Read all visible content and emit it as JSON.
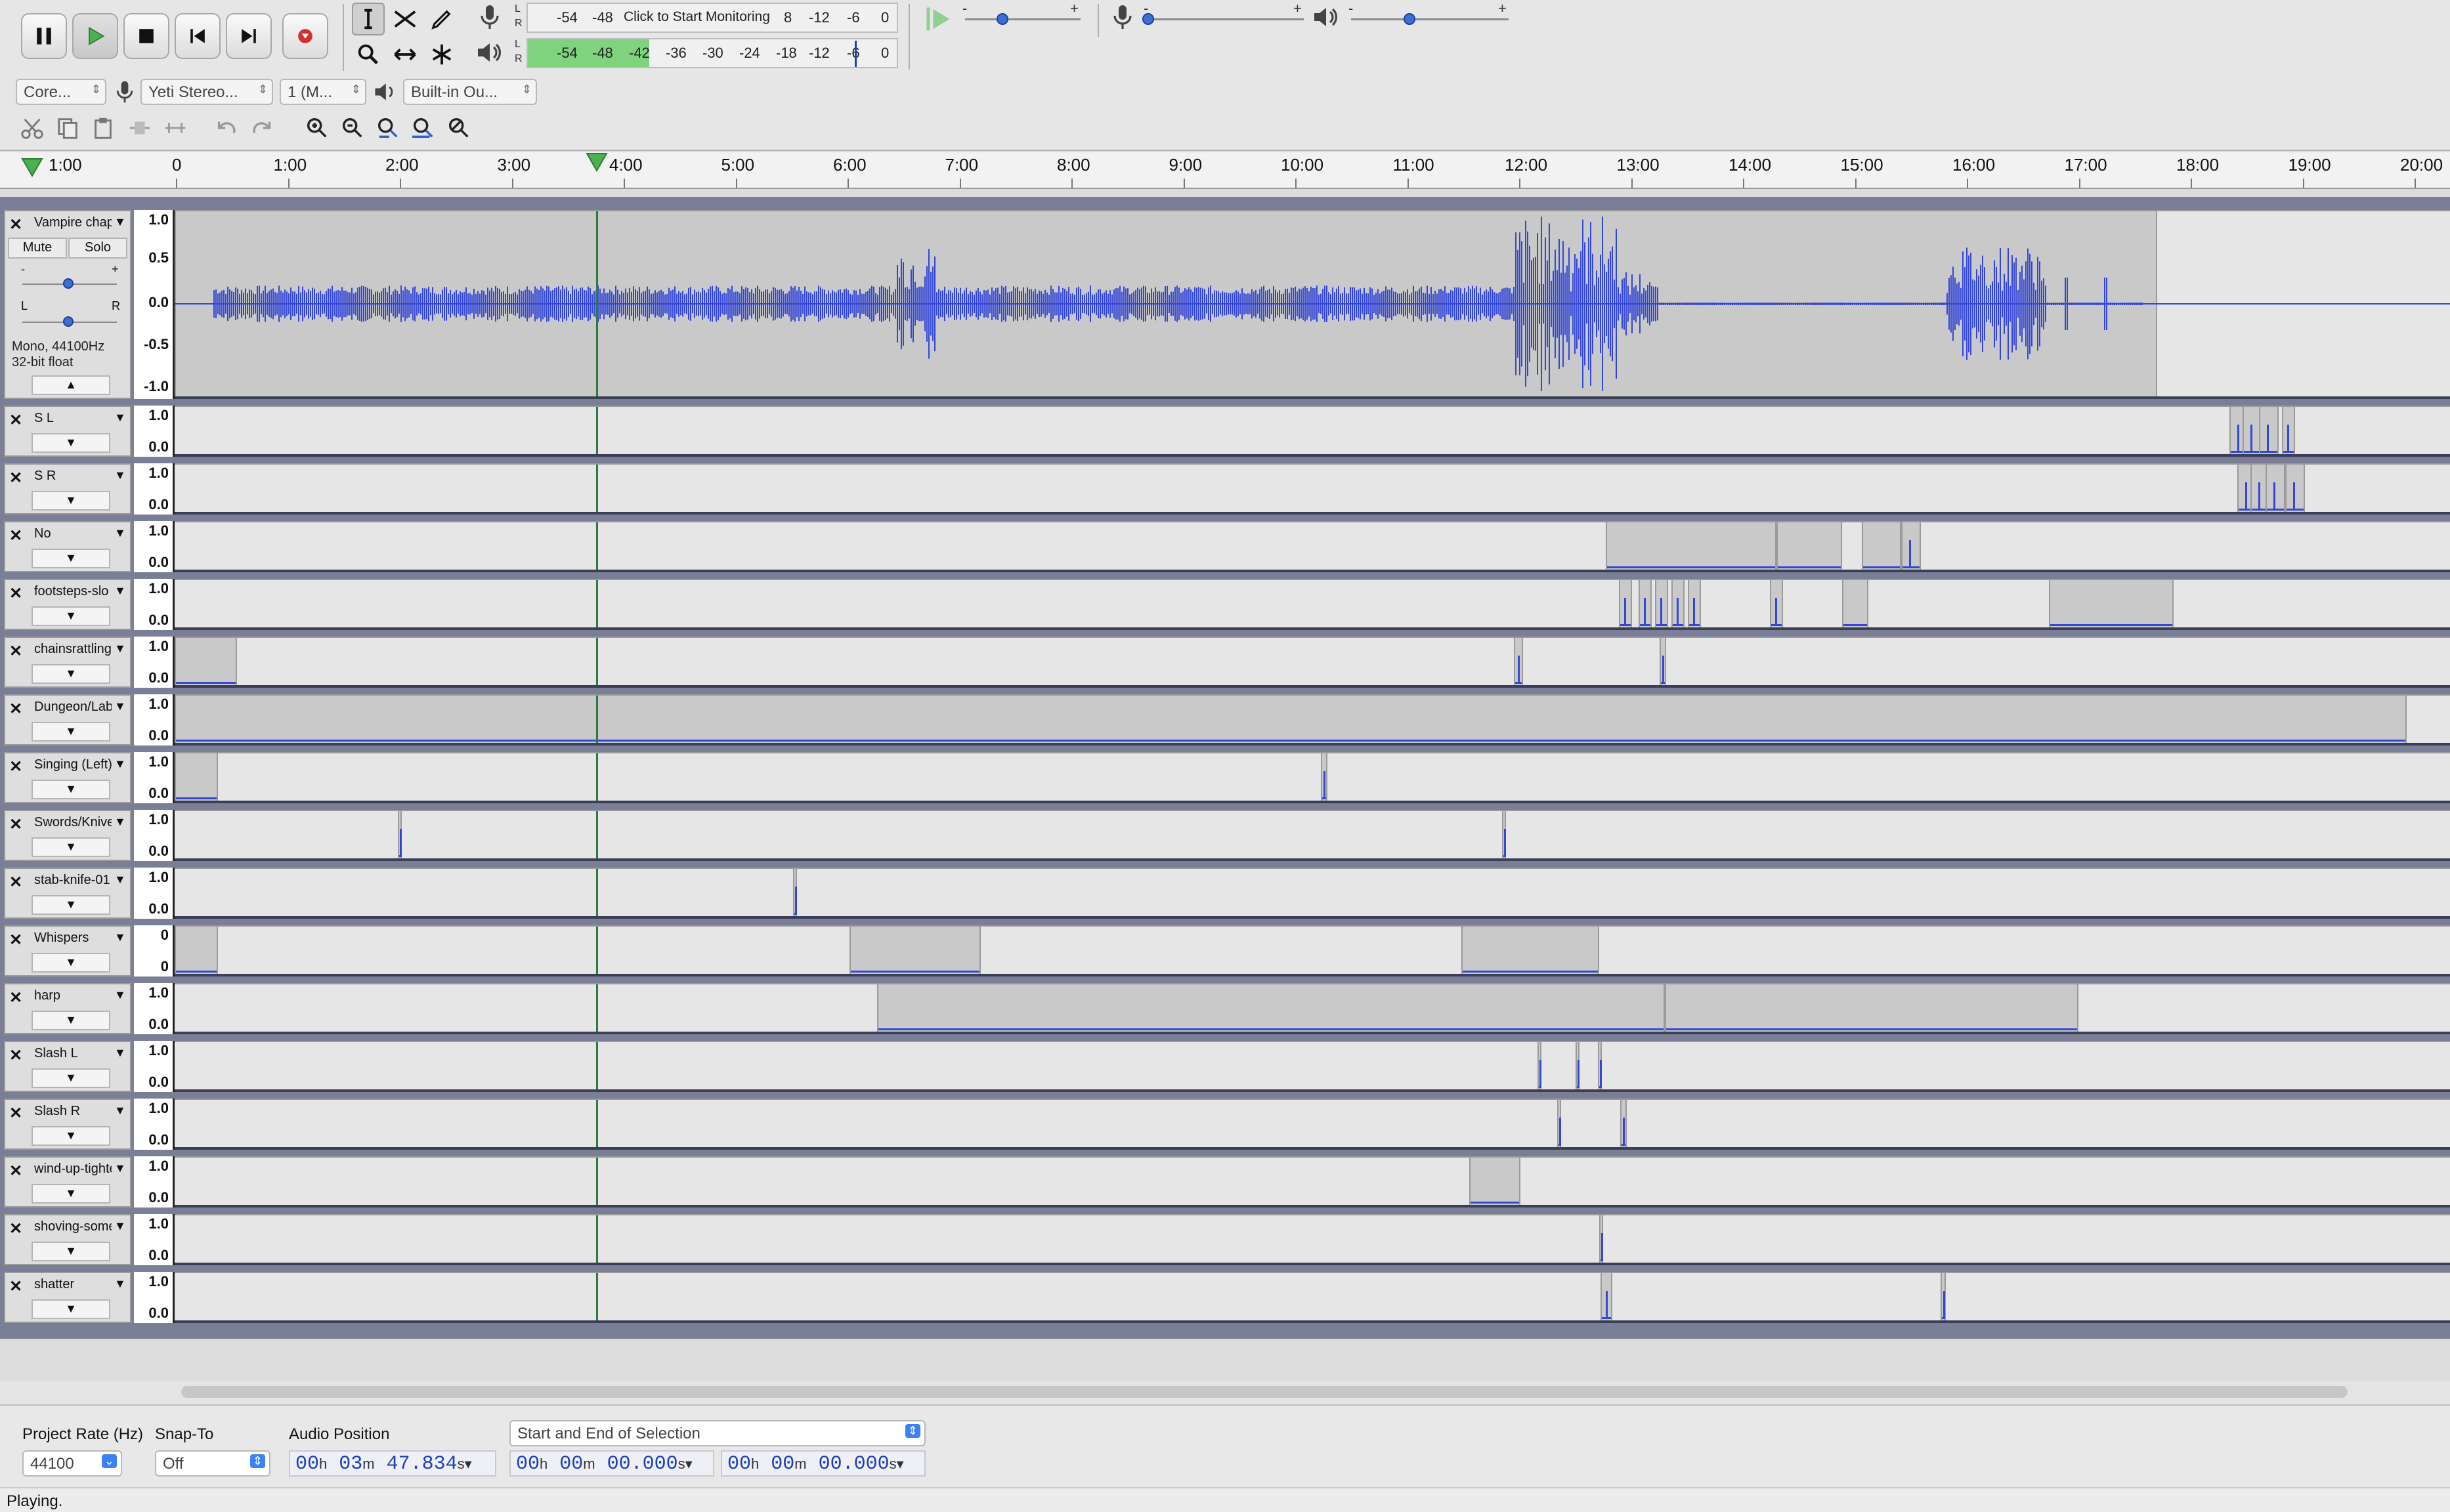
{
  "toolbar": {
    "monitor_text": "Click to Start Monitoring",
    "rec_ticks": [
      "-54",
      "-48",
      "8",
      "-12",
      "-6",
      "0"
    ],
    "play_ticks": [
      "-54",
      "-48",
      "-42",
      "-36",
      "-30",
      "-24",
      "-18",
      "-12",
      "-6",
      "0"
    ],
    "meter_l": "L",
    "meter_r": "R",
    "slider_minus": "-",
    "slider_plus": "+",
    "play_meter_level": 0.33
  },
  "devices": {
    "host": "Core...",
    "input": "Yeti Stereo...",
    "channels": "1 (M...",
    "output": "Built-in Ou..."
  },
  "ruler": {
    "start_label": "1:00",
    "labels": [
      "0",
      "1:00",
      "2:00",
      "3:00",
      "4:00",
      "5:00",
      "6:00",
      "7:00",
      "8:00",
      "9:00",
      "10:00",
      "11:00",
      "12:00",
      "13:00",
      "14:00",
      "15:00",
      "16:00",
      "17:00",
      "18:00",
      "19:00",
      "20:00"
    ]
  },
  "first_track": {
    "name": "Vampire chap",
    "mute": "Mute",
    "solo": "Solo",
    "gain_minus": "-",
    "gain_plus": "+",
    "pan_l": "L",
    "pan_r": "R",
    "format_line1": "Mono, 44100Hz",
    "format_line2": "32-bit float",
    "scale": [
      "1.0",
      "0.5",
      "0.0",
      "-0.5",
      "-1.0"
    ]
  },
  "tracks": [
    {
      "name": "S L",
      "scale_top": "1.0",
      "scale_bottom": "0.0"
    },
    {
      "name": "S R",
      "scale_top": "1.0",
      "scale_bottom": "0.0"
    },
    {
      "name": "No",
      "scale_top": "1.0",
      "scale_bottom": "0.0"
    },
    {
      "name": "footsteps-slo",
      "scale_top": "1.0",
      "scale_bottom": "0.0"
    },
    {
      "name": "chainsrattling",
      "scale_top": "1.0",
      "scale_bottom": "0.0"
    },
    {
      "name": "Dungeon/Lab",
      "scale_top": "1.0",
      "scale_bottom": "0.0"
    },
    {
      "name": "Singing (Left)",
      "scale_top": "1.0",
      "scale_bottom": "0.0"
    },
    {
      "name": "Swords/Knive",
      "scale_top": "1.0",
      "scale_bottom": "0.0"
    },
    {
      "name": "stab-knife-01",
      "scale_top": "1.0",
      "scale_bottom": "0.0"
    },
    {
      "name": "Whispers",
      "scale_top": "0",
      "scale_bottom": "0"
    },
    {
      "name": "harp",
      "scale_top": "1.0",
      "scale_bottom": "0.0"
    },
    {
      "name": "Slash L",
      "scale_top": "1.0",
      "scale_bottom": "0.0"
    },
    {
      "name": "Slash R",
      "scale_top": "1.0",
      "scale_bottom": "0.0"
    },
    {
      "name": "wind-up-tighte",
      "scale_top": "1.0",
      "scale_bottom": "0.0"
    },
    {
      "name": "shoving-some",
      "scale_top": "1.0",
      "scale_bottom": "0.0"
    },
    {
      "name": "shatter",
      "scale_top": "1.0",
      "scale_bottom": "0.0"
    }
  ],
  "selection_bar": {
    "project_rate_label": "Project Rate (Hz)",
    "project_rate": "44100",
    "snap_to_label": "Snap-To",
    "snap_to": "Off",
    "audio_position_label": "Audio Position",
    "audio_position": {
      "h": "00",
      "m": "03",
      "s": "47.834"
    },
    "selection_mode": "Start and End of Selection",
    "sel_start": {
      "h": "00",
      "m": "00",
      "s": "00.000"
    },
    "sel_end": {
      "h": "00",
      "m": "00",
      "s": "00.000"
    },
    "unit_h": "h",
    "unit_m": "m",
    "unit_s": "s"
  },
  "status": "Playing.",
  "colors": {
    "waveform": "#3346d6",
    "clip": "#c9c9c9",
    "background": "#7a7f97"
  }
}
